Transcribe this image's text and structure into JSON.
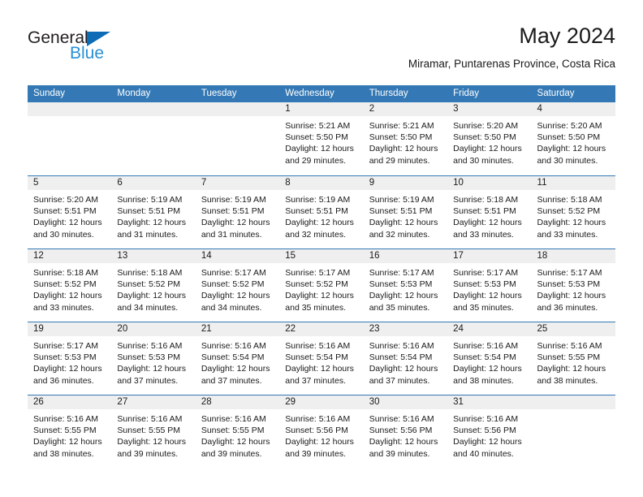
{
  "brand": {
    "word_one": "General",
    "word_two": "Blue",
    "triangle_icon": "triangle-icon",
    "color_dark": "#231f20",
    "color_blue": "#2b8fd4",
    "color_triangle": "#0d6cb5"
  },
  "header": {
    "title": "May 2024",
    "subtitle": "Miramar, Puntarenas Province, Costa Rica"
  },
  "theme": {
    "header_blue": "#3479b5",
    "band_gray": "#efefef",
    "text": "#1a1a1a"
  },
  "weekdays": [
    "Sunday",
    "Monday",
    "Tuesday",
    "Wednesday",
    "Thursday",
    "Friday",
    "Saturday"
  ],
  "weeks": [
    [
      {
        "day": ""
      },
      {
        "day": ""
      },
      {
        "day": ""
      },
      {
        "day": "1",
        "sunrise": "Sunrise: 5:21 AM",
        "sunset": "Sunset: 5:50 PM",
        "daylight_1": "Daylight: 12 hours",
        "daylight_2": "and 29 minutes."
      },
      {
        "day": "2",
        "sunrise": "Sunrise: 5:21 AM",
        "sunset": "Sunset: 5:50 PM",
        "daylight_1": "Daylight: 12 hours",
        "daylight_2": "and 29 minutes."
      },
      {
        "day": "3",
        "sunrise": "Sunrise: 5:20 AM",
        "sunset": "Sunset: 5:50 PM",
        "daylight_1": "Daylight: 12 hours",
        "daylight_2": "and 30 minutes."
      },
      {
        "day": "4",
        "sunrise": "Sunrise: 5:20 AM",
        "sunset": "Sunset: 5:50 PM",
        "daylight_1": "Daylight: 12 hours",
        "daylight_2": "and 30 minutes."
      }
    ],
    [
      {
        "day": "5",
        "sunrise": "Sunrise: 5:20 AM",
        "sunset": "Sunset: 5:51 PM",
        "daylight_1": "Daylight: 12 hours",
        "daylight_2": "and 30 minutes."
      },
      {
        "day": "6",
        "sunrise": "Sunrise: 5:19 AM",
        "sunset": "Sunset: 5:51 PM",
        "daylight_1": "Daylight: 12 hours",
        "daylight_2": "and 31 minutes."
      },
      {
        "day": "7",
        "sunrise": "Sunrise: 5:19 AM",
        "sunset": "Sunset: 5:51 PM",
        "daylight_1": "Daylight: 12 hours",
        "daylight_2": "and 31 minutes."
      },
      {
        "day": "8",
        "sunrise": "Sunrise: 5:19 AM",
        "sunset": "Sunset: 5:51 PM",
        "daylight_1": "Daylight: 12 hours",
        "daylight_2": "and 32 minutes."
      },
      {
        "day": "9",
        "sunrise": "Sunrise: 5:19 AM",
        "sunset": "Sunset: 5:51 PM",
        "daylight_1": "Daylight: 12 hours",
        "daylight_2": "and 32 minutes."
      },
      {
        "day": "10",
        "sunrise": "Sunrise: 5:18 AM",
        "sunset": "Sunset: 5:51 PM",
        "daylight_1": "Daylight: 12 hours",
        "daylight_2": "and 33 minutes."
      },
      {
        "day": "11",
        "sunrise": "Sunrise: 5:18 AM",
        "sunset": "Sunset: 5:52 PM",
        "daylight_1": "Daylight: 12 hours",
        "daylight_2": "and 33 minutes."
      }
    ],
    [
      {
        "day": "12",
        "sunrise": "Sunrise: 5:18 AM",
        "sunset": "Sunset: 5:52 PM",
        "daylight_1": "Daylight: 12 hours",
        "daylight_2": "and 33 minutes."
      },
      {
        "day": "13",
        "sunrise": "Sunrise: 5:18 AM",
        "sunset": "Sunset: 5:52 PM",
        "daylight_1": "Daylight: 12 hours",
        "daylight_2": "and 34 minutes."
      },
      {
        "day": "14",
        "sunrise": "Sunrise: 5:17 AM",
        "sunset": "Sunset: 5:52 PM",
        "daylight_1": "Daylight: 12 hours",
        "daylight_2": "and 34 minutes."
      },
      {
        "day": "15",
        "sunrise": "Sunrise: 5:17 AM",
        "sunset": "Sunset: 5:52 PM",
        "daylight_1": "Daylight: 12 hours",
        "daylight_2": "and 35 minutes."
      },
      {
        "day": "16",
        "sunrise": "Sunrise: 5:17 AM",
        "sunset": "Sunset: 5:53 PM",
        "daylight_1": "Daylight: 12 hours",
        "daylight_2": "and 35 minutes."
      },
      {
        "day": "17",
        "sunrise": "Sunrise: 5:17 AM",
        "sunset": "Sunset: 5:53 PM",
        "daylight_1": "Daylight: 12 hours",
        "daylight_2": "and 35 minutes."
      },
      {
        "day": "18",
        "sunrise": "Sunrise: 5:17 AM",
        "sunset": "Sunset: 5:53 PM",
        "daylight_1": "Daylight: 12 hours",
        "daylight_2": "and 36 minutes."
      }
    ],
    [
      {
        "day": "19",
        "sunrise": "Sunrise: 5:17 AM",
        "sunset": "Sunset: 5:53 PM",
        "daylight_1": "Daylight: 12 hours",
        "daylight_2": "and 36 minutes."
      },
      {
        "day": "20",
        "sunrise": "Sunrise: 5:16 AM",
        "sunset": "Sunset: 5:53 PM",
        "daylight_1": "Daylight: 12 hours",
        "daylight_2": "and 37 minutes."
      },
      {
        "day": "21",
        "sunrise": "Sunrise: 5:16 AM",
        "sunset": "Sunset: 5:54 PM",
        "daylight_1": "Daylight: 12 hours",
        "daylight_2": "and 37 minutes."
      },
      {
        "day": "22",
        "sunrise": "Sunrise: 5:16 AM",
        "sunset": "Sunset: 5:54 PM",
        "daylight_1": "Daylight: 12 hours",
        "daylight_2": "and 37 minutes."
      },
      {
        "day": "23",
        "sunrise": "Sunrise: 5:16 AM",
        "sunset": "Sunset: 5:54 PM",
        "daylight_1": "Daylight: 12 hours",
        "daylight_2": "and 37 minutes."
      },
      {
        "day": "24",
        "sunrise": "Sunrise: 5:16 AM",
        "sunset": "Sunset: 5:54 PM",
        "daylight_1": "Daylight: 12 hours",
        "daylight_2": "and 38 minutes."
      },
      {
        "day": "25",
        "sunrise": "Sunrise: 5:16 AM",
        "sunset": "Sunset: 5:55 PM",
        "daylight_1": "Daylight: 12 hours",
        "daylight_2": "and 38 minutes."
      }
    ],
    [
      {
        "day": "26",
        "sunrise": "Sunrise: 5:16 AM",
        "sunset": "Sunset: 5:55 PM",
        "daylight_1": "Daylight: 12 hours",
        "daylight_2": "and 38 minutes."
      },
      {
        "day": "27",
        "sunrise": "Sunrise: 5:16 AM",
        "sunset": "Sunset: 5:55 PM",
        "daylight_1": "Daylight: 12 hours",
        "daylight_2": "and 39 minutes."
      },
      {
        "day": "28",
        "sunrise": "Sunrise: 5:16 AM",
        "sunset": "Sunset: 5:55 PM",
        "daylight_1": "Daylight: 12 hours",
        "daylight_2": "and 39 minutes."
      },
      {
        "day": "29",
        "sunrise": "Sunrise: 5:16 AM",
        "sunset": "Sunset: 5:56 PM",
        "daylight_1": "Daylight: 12 hours",
        "daylight_2": "and 39 minutes."
      },
      {
        "day": "30",
        "sunrise": "Sunrise: 5:16 AM",
        "sunset": "Sunset: 5:56 PM",
        "daylight_1": "Daylight: 12 hours",
        "daylight_2": "and 39 minutes."
      },
      {
        "day": "31",
        "sunrise": "Sunrise: 5:16 AM",
        "sunset": "Sunset: 5:56 PM",
        "daylight_1": "Daylight: 12 hours",
        "daylight_2": "and 40 minutes."
      },
      {
        "day": ""
      }
    ]
  ]
}
